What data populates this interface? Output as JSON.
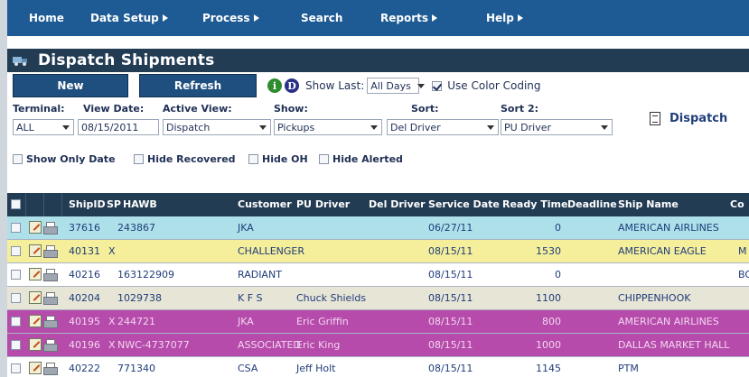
{
  "nav": {
    "items": [
      {
        "label": "Home",
        "arrow": false
      },
      {
        "label": "Data Setup",
        "arrow": true
      },
      {
        "label": "Process",
        "arrow": true
      },
      {
        "label": "Search",
        "arrow": false
      },
      {
        "label": "Reports",
        "arrow": true
      },
      {
        "label": "Help",
        "arrow": true
      }
    ]
  },
  "page": {
    "title": "Dispatch Shipments"
  },
  "toolbar": {
    "new_label": "New",
    "refresh_label": "Refresh",
    "info_icon_letter": "i",
    "d_icon_letter": "D",
    "show_last_label": "Show Last:",
    "show_last_value": "All Days",
    "color_coding_label": "Use Color Coding",
    "color_coding_checked": true
  },
  "filters": {
    "terminal": {
      "label": "Terminal:",
      "value": "ALL"
    },
    "view_date": {
      "label": "View Date:",
      "value": "08/15/2011"
    },
    "active_view": {
      "label": "Active View:",
      "value": "Dispatch"
    },
    "show": {
      "label": "Show:",
      "value": "Pickups"
    },
    "sort": {
      "label": "Sort:",
      "value": "Del Driver"
    },
    "sort2": {
      "label": "Sort 2:",
      "value": "PU Driver"
    },
    "dispatch_link": "Dispatch"
  },
  "flags": [
    {
      "label": "Show Only Date",
      "checked": false
    },
    {
      "label": "Hide Recovered",
      "checked": false
    },
    {
      "label": "Hide OH",
      "checked": false
    },
    {
      "label": "Hide Alerted",
      "checked": false
    }
  ],
  "grid": {
    "columns": [
      "ShipID",
      "SP",
      "HAWB",
      "Customer",
      "PU Driver",
      "Del Driver",
      "Service Date",
      "Ready Time",
      "Deadline",
      "Ship Name",
      "Co"
    ],
    "rows": [
      {
        "bg": "#aee0ea",
        "fg": "#1f3d7a",
        "shipid": "37616",
        "sp": "",
        "hawb": "243867",
        "customer": "JKA",
        "pu_driver": "",
        "del_driver": "",
        "service_date": "06/27/11",
        "ready_time": "0",
        "deadline": "",
        "ship_name": "AMERICAN AIRLINES",
        "co": ""
      },
      {
        "bg": "#f5ee9a",
        "fg": "#1f3d7a",
        "shipid": "40131",
        "sp": "X",
        "hawb": "",
        "customer": "CHALLENGER",
        "pu_driver": "",
        "del_driver": "",
        "service_date": "08/15/11",
        "ready_time": "1530",
        "deadline": "",
        "ship_name": "AMERICAN EAGLE",
        "co": "M"
      },
      {
        "bg": "#ffffff",
        "fg": "#1f3d7a",
        "shipid": "40216",
        "sp": "",
        "hawb": "163122909",
        "customer": "RADIANT",
        "pu_driver": "",
        "del_driver": "",
        "service_date": "08/15/11",
        "ready_time": "0",
        "deadline": "",
        "ship_name": "",
        "co": "BO"
      },
      {
        "bg": "#e7e5d6",
        "fg": "#1f3d7a",
        "shipid": "40204",
        "sp": "",
        "hawb": "1029738",
        "customer": "K F S",
        "pu_driver": "Chuck Shields",
        "del_driver": "",
        "service_date": "08/15/11",
        "ready_time": "1100",
        "deadline": "",
        "ship_name": "CHIPPENHOOK",
        "co": ""
      },
      {
        "bg": "#b64bab",
        "fg": "#f2d6ef",
        "shipid": "40195",
        "sp": "X",
        "hawb": "244721",
        "customer": "JKA",
        "pu_driver": "Eric Griffin",
        "del_driver": "",
        "service_date": "08/15/11",
        "ready_time": "800",
        "deadline": "",
        "ship_name": "AMERICAN AIRLINES",
        "co": ""
      },
      {
        "bg": "#b64bab",
        "fg": "#f2d6ef",
        "shipid": "40196",
        "sp": "X",
        "hawb": "NWC-4737077",
        "customer": "ASSOCIATED",
        "pu_driver": "Eric King",
        "del_driver": "",
        "service_date": "08/15/11",
        "ready_time": "1000",
        "deadline": "",
        "ship_name": "DALLAS MARKET HALL",
        "co": ""
      },
      {
        "bg": "#ffffff",
        "fg": "#1f3d7a",
        "shipid": "40222",
        "sp": "",
        "hawb": "771340",
        "customer": "CSA",
        "pu_driver": "Jeff Holt",
        "del_driver": "",
        "service_date": "08/15/11",
        "ready_time": "1145",
        "deadline": "",
        "ship_name": "PTM",
        "co": ""
      }
    ]
  },
  "colors": {
    "nav_bg": "#1e5a93",
    "header_bg": "#223c54",
    "button_bg": "#1e4f7e"
  },
  "icons": [
    "info-icon",
    "d-icon",
    "dispatch-doc-icon",
    "edit-icon",
    "print-icon"
  ]
}
